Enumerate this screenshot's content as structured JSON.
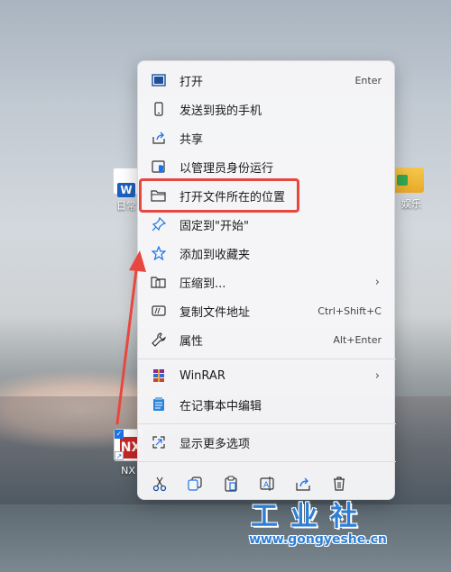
{
  "desktop": {
    "word_label": "日常",
    "folder_label": "娱乐",
    "nx_label": "NX"
  },
  "menu": {
    "items": [
      {
        "label": "打开",
        "shortcut": "Enter",
        "icon": "open-app-icon"
      },
      {
        "label": "发送到我的手机",
        "shortcut": "",
        "icon": "phone-icon"
      },
      {
        "label": "共享",
        "shortcut": "",
        "icon": "share-icon"
      },
      {
        "label": "以管理员身份运行",
        "shortcut": "",
        "icon": "admin-shield-icon"
      },
      {
        "label": "打开文件所在的位置",
        "shortcut": "",
        "icon": "folder-icon"
      },
      {
        "label": "固定到\"开始\"",
        "shortcut": "",
        "icon": "pin-icon"
      },
      {
        "label": "添加到收藏夹",
        "shortcut": "",
        "icon": "star-icon"
      },
      {
        "label": "压缩到...",
        "shortcut": "",
        "icon": "zip-icon",
        "submenu": true
      },
      {
        "label": "复制文件地址",
        "shortcut": "Ctrl+Shift+C",
        "icon": "copy-path-icon"
      },
      {
        "label": "属性",
        "shortcut": "Alt+Enter",
        "icon": "wrench-icon"
      },
      {
        "label": "WinRAR",
        "shortcut": "",
        "icon": "winrar-icon",
        "submenu": true
      },
      {
        "label": "在记事本中编辑",
        "shortcut": "",
        "icon": "notepad-icon"
      },
      {
        "label": "显示更多选项",
        "shortcut": "",
        "icon": "more-options-icon"
      }
    ],
    "toolbar": [
      "cut-icon",
      "copy-icon",
      "paste-icon",
      "rename-icon",
      "share-icon",
      "delete-icon"
    ]
  },
  "colors": {
    "highlight": "#e8473f",
    "accent": "#2d7fd6"
  },
  "watermark": {
    "title": "工业社",
    "url": "www.gongyeshe.cn"
  }
}
